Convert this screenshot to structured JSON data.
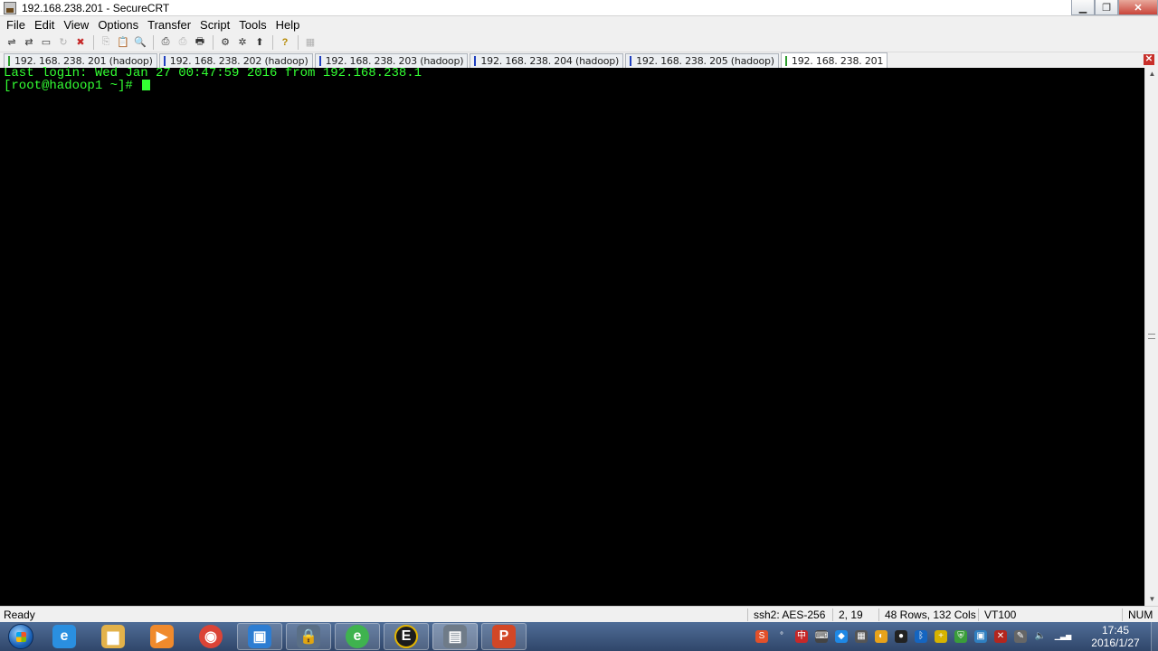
{
  "window": {
    "title": "192.168.238.201 - SecureCRT",
    "minimize_glyph": "▁",
    "restore_glyph": "❐",
    "close_glyph": "✕"
  },
  "menu": {
    "items": [
      "File",
      "Edit",
      "View",
      "Options",
      "Transfer",
      "Script",
      "Tools",
      "Help"
    ]
  },
  "toolbar": {
    "buttons": [
      {
        "icon": "connect-icon",
        "glyph": "⇌"
      },
      {
        "icon": "quick-connect-icon",
        "glyph": "⇄"
      },
      {
        "icon": "connect-in-tab-icon",
        "glyph": "▭"
      },
      {
        "icon": "reconnect-icon",
        "glyph": "↻"
      },
      {
        "icon": "disconnect-icon",
        "glyph": "✖"
      },
      {
        "icon": "copy-icon",
        "glyph": "⎘"
      },
      {
        "icon": "paste-icon",
        "glyph": "📋"
      },
      {
        "icon": "find-icon",
        "glyph": "🔍"
      },
      {
        "icon": "print-icon",
        "glyph": "⎙"
      },
      {
        "icon": "print-selection-icon",
        "glyph": "⎙"
      },
      {
        "icon": "printer-icon",
        "glyph": "🖶"
      },
      {
        "icon": "session-options-icon",
        "glyph": "⚙"
      },
      {
        "icon": "global-options-icon",
        "glyph": "✲"
      },
      {
        "icon": "keymap-icon",
        "glyph": "⬆"
      },
      {
        "icon": "help-icon",
        "glyph": "?"
      },
      {
        "icon": "sftp-icon",
        "glyph": "▦"
      }
    ]
  },
  "tabs": [
    {
      "label": "192. 168. 238. 201 (hadoop)",
      "status_color": "#2e9d2e",
      "active": false
    },
    {
      "label": "192. 168. 238. 202 (hadoop)",
      "status_color": "#1f3fbf",
      "active": false
    },
    {
      "label": "192. 168. 238. 203 (hadoop)",
      "status_color": "#1f3fbf",
      "active": false
    },
    {
      "label": "192. 168. 238. 204 (hadoop)",
      "status_color": "#1f3fbf",
      "active": false
    },
    {
      "label": "192. 168. 238. 205 (hadoop)",
      "status_color": "#1f3fbf",
      "active": false
    },
    {
      "label": "192. 168. 238. 201",
      "status_color": "#2e9d2e",
      "active": true
    }
  ],
  "tab_close_glyph": "✕",
  "terminal": {
    "lines": [
      "Last login: Wed Jan 27 00:47:59 2016 from 192.168.238.1",
      "[root@hadoop1 ~]# "
    ],
    "fg_color": "#33ff33",
    "bg_color": "#000000"
  },
  "scrollbar": {
    "up_glyph": "▲",
    "down_glyph": "▼"
  },
  "status": {
    "ready": "Ready",
    "protocol": "ssh2: AES-256",
    "cursor_pos": "2,  19",
    "size": "48 Rows, 132 Cols",
    "emulation": "VT100",
    "num": "NUM"
  },
  "taskbar": {
    "apps": [
      {
        "name": "internet-explorer",
        "glyph": "e",
        "color": "#2a8fe0"
      },
      {
        "name": "file-explorer",
        "glyph": "▆",
        "color": "#e3b24a"
      },
      {
        "name": "media-player",
        "glyph": "▶",
        "color": "#f08a2c"
      },
      {
        "name": "chrome",
        "glyph": "◉",
        "color": "#db4437"
      },
      {
        "name": "virtual-machine",
        "glyph": "▣",
        "color": "#2d7dd2"
      },
      {
        "name": "security-tool",
        "glyph": "🔒",
        "color": "#5a6f86"
      },
      {
        "name": "browser",
        "glyph": "e",
        "color": "#3fb34f"
      },
      {
        "name": "editor",
        "glyph": "E",
        "color": "#1c1c1c"
      },
      {
        "name": "securecrt",
        "glyph": "▤",
        "color": "#6f7b88"
      },
      {
        "name": "powerpoint",
        "glyph": "P",
        "color": "#d24726"
      }
    ],
    "tray": [
      {
        "name": "ime",
        "glyph": "S",
        "color": "#e2502a"
      },
      {
        "name": "punctuation",
        "glyph": "°",
        "color": "transparent"
      },
      {
        "name": "chinese-input",
        "glyph": "中",
        "color": "#c62828"
      },
      {
        "name": "keyboard",
        "glyph": "⌨",
        "color": "#444"
      },
      {
        "name": "shield",
        "glyph": "◆",
        "color": "#1e88e5"
      },
      {
        "name": "windows",
        "glyph": "▦",
        "color": "#555"
      },
      {
        "name": "monitor",
        "glyph": "◐",
        "color": "#e7a21a"
      },
      {
        "name": "qq",
        "glyph": "●",
        "color": "#222"
      },
      {
        "name": "bluetooth",
        "glyph": "ᛒ",
        "color": "#1565c0"
      },
      {
        "name": "plus",
        "glyph": "+",
        "color": "#d6b300"
      },
      {
        "name": "defender",
        "glyph": "⛨",
        "color": "#3a9d3a"
      },
      {
        "name": "network-device",
        "glyph": "▣",
        "color": "#2f7fc0"
      },
      {
        "name": "remove-device",
        "glyph": "✕",
        "color": "#b3261e"
      },
      {
        "name": "pen",
        "glyph": "✎",
        "color": "#666"
      },
      {
        "name": "volume",
        "glyph": "🔈",
        "color": "transparent"
      },
      {
        "name": "signal",
        "glyph": "▁▃▅",
        "color": "transparent"
      }
    ],
    "time": "17:45",
    "date": "2016/1/27"
  }
}
